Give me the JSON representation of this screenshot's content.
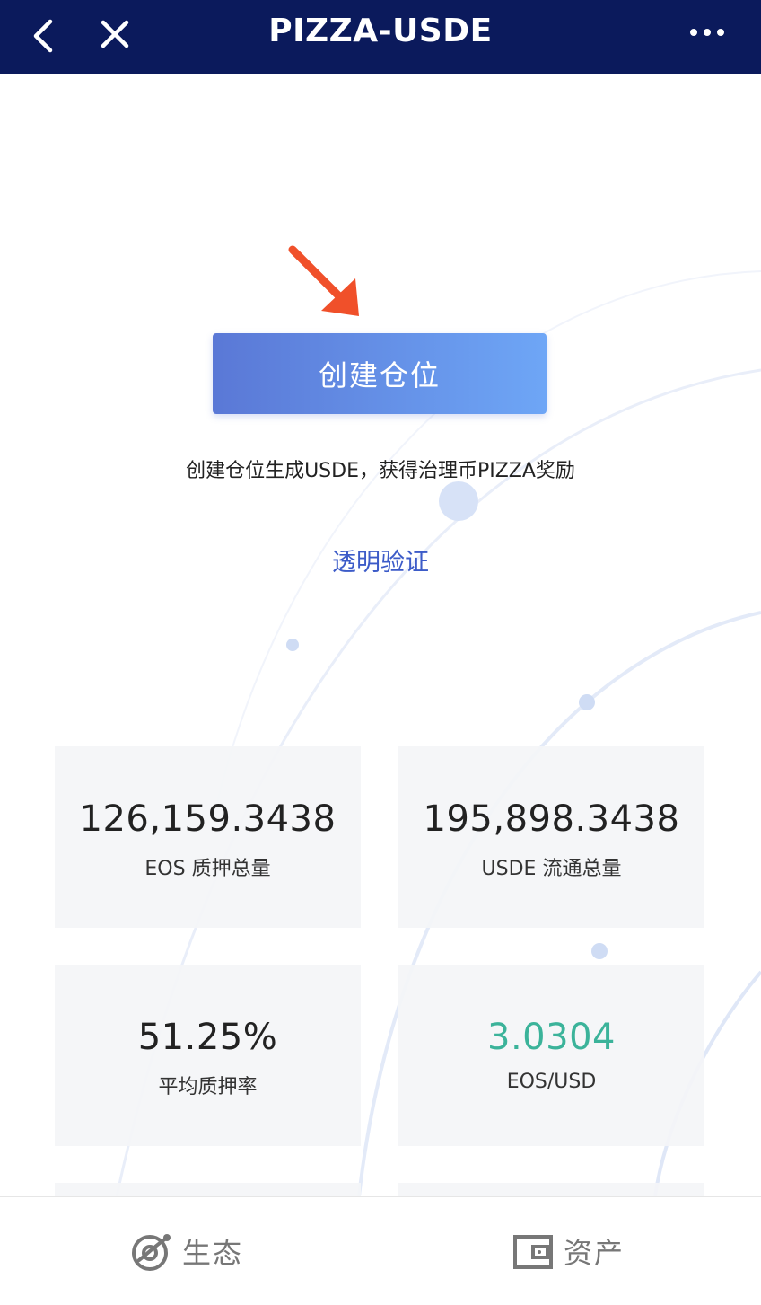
{
  "header": {
    "title": "PIZZA-USDE",
    "back_icon": "chevron-left-icon",
    "close_icon": "close-icon",
    "more_icon": "more-dots-icon"
  },
  "main": {
    "create_button_label": "创建仓位",
    "hint_text": "创建仓位生成USDE，获得治理币PIZZA奖励",
    "verify_link": "透明验证"
  },
  "stats": [
    {
      "value": "126,159.3438",
      "label": "EOS 质押总量"
    },
    {
      "value": "195,898.3438",
      "label": "USDE 流通总量"
    },
    {
      "value": "51.25%",
      "label": "平均质押率"
    },
    {
      "value": "3.0304",
      "label": "EOS/USD",
      "color": "#3bb39a"
    }
  ],
  "tabbar": {
    "eco_label": "生态",
    "assets_label": "资产"
  },
  "colors": {
    "header_bg": "#0b1a5c",
    "button_gradient_start": "#5a78d6",
    "button_gradient_end": "#6ea6f6",
    "link": "#3c5bc8",
    "arrow": "#f0502a"
  }
}
